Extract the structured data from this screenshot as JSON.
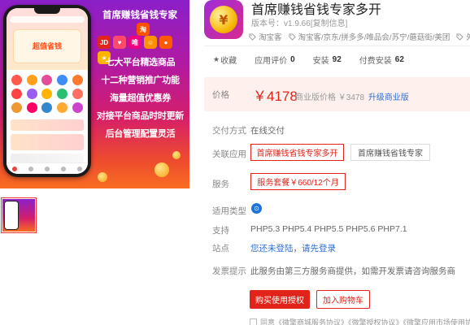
{
  "banner": {
    "title": "首席赚钱省钱专家",
    "phone_card_text": "超值省钱",
    "logo_chips": [
      {
        "text": "JD",
        "color": "#e1251b"
      },
      {
        "text": "♥",
        "color": "#ff4a6e"
      },
      {
        "text": "唯",
        "color": "#f10180"
      },
      {
        "text": "☺",
        "color": "#ff9000"
      },
      {
        "text": "●",
        "color": "#ff5a00"
      },
      {
        "text": "★",
        "color": "#ffb400"
      }
    ],
    "logo_tao": "淘",
    "lines": [
      "七大平台精选商品",
      "十二种营销推广功能",
      "海量超值优惠券",
      "对接平台商品时时更新",
      "后台管理配置灵活"
    ]
  },
  "app": {
    "icon_char": "¥",
    "title": "首席赚钱省钱专家多开",
    "version_prefix": "版本号：v1.9.66",
    "copy_info": "[复制信息]",
    "tags": [
      "淘宝客",
      "淘宝客/京东/拼多多/唯品会/苏宁/蘑菇街/美团",
      "外卖"
    ]
  },
  "stats": {
    "favorite_label": "收藏",
    "rating_label": "应用评价",
    "rating_value": "0",
    "installs_label": "安装",
    "installs_value": "92",
    "paid_label": "付费安装",
    "paid_value": "62"
  },
  "price": {
    "label": "价格",
    "main": "￥4178",
    "sub": "商业版价格 ￥3478",
    "upgrade": "升级商业版"
  },
  "delivery": {
    "label": "交付方式",
    "value": "在线交付"
  },
  "related": {
    "label": "关联应用",
    "options": [
      "首席赚钱省钱专家多开",
      "首席赚钱省钱专家"
    ]
  },
  "service": {
    "label": "服务",
    "option": "服务套餐￥660/12个月"
  },
  "platform": {
    "label": "适用类型",
    "icon_char": "⊙"
  },
  "support": {
    "label": "支持",
    "value": "PHP5.3 PHP5.4 PHP5.5 PHP5.6 PHP7.1"
  },
  "site": {
    "label": "站点",
    "prefix": "您还未登陆，",
    "link": "请先登录"
  },
  "invoice": {
    "label": "发票提示",
    "value": "此服务由第三方服务商提供，如需开发票请咨询服务商"
  },
  "actions": {
    "buy": "购买使用授权",
    "cart": "加入购物车"
  },
  "agreement": {
    "text": "同意《微擎商城服务协议》《微擎授权协议》《微擎应用市场使用协议》"
  },
  "colors": {
    "accent": "#e2231a",
    "link": "#2b6fd6",
    "price_bg": "#fdf0ed"
  }
}
